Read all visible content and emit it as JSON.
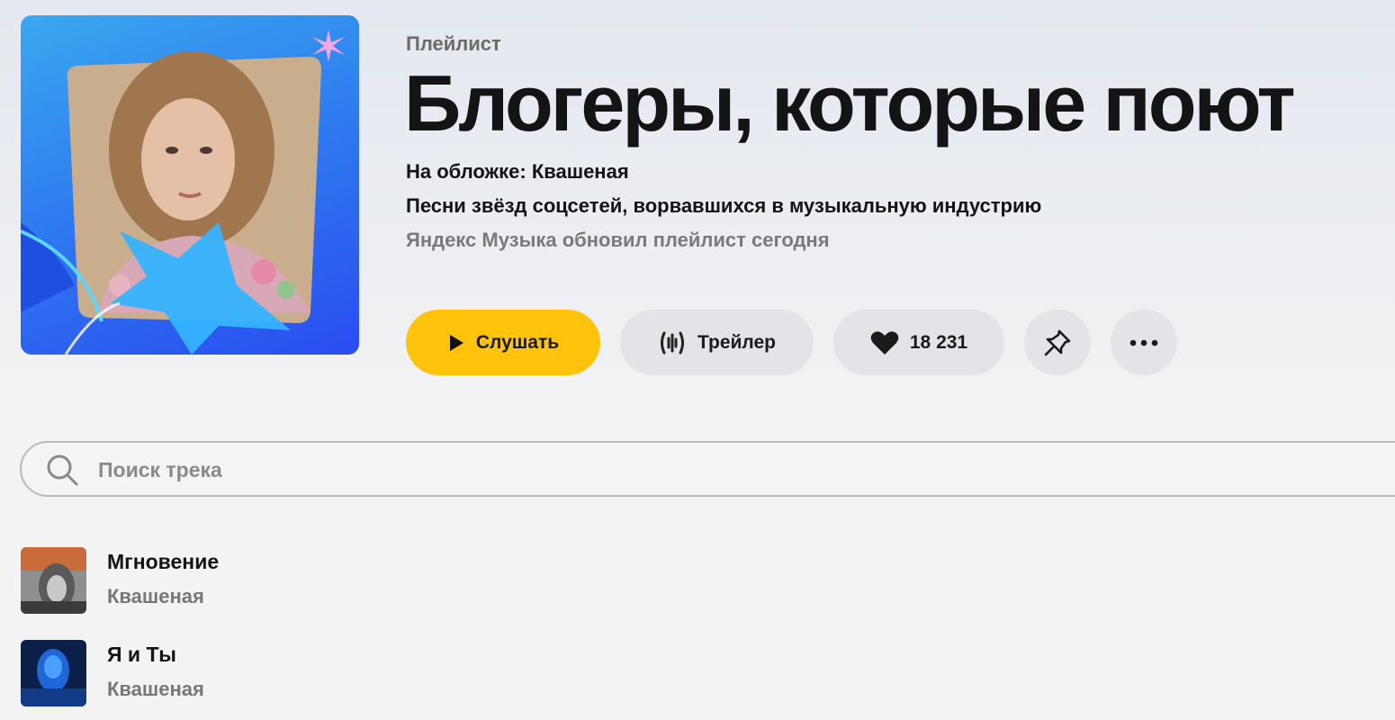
{
  "header": {
    "kind": "Плейлист",
    "title": "Блогеры, которые поют",
    "cover_note": "На обложке: Квашеная",
    "description": "Песни звёзд соцсетей, ворвавшихся в музыкальную индустрию",
    "updated": "Яндекс Музыка обновил плейлист сегодня"
  },
  "actions": {
    "play_label": "Слушать",
    "trailer_label": "Трейлер",
    "likes_count": "18 231"
  },
  "search": {
    "placeholder": "Поиск трека"
  },
  "tracks": [
    {
      "title": "Мгновение",
      "artist": "Квашеная"
    },
    {
      "title": "Я и Ты",
      "artist": "Квашеная"
    }
  ],
  "colors": {
    "accent": "#ffc30c",
    "button_bg": "#e3e4e7",
    "cover_blue": "#2f7df0"
  },
  "icons": [
    "play-icon",
    "waveform-icon",
    "heart-icon",
    "pin-icon",
    "more-icon",
    "search-icon",
    "sparkle-icon"
  ]
}
